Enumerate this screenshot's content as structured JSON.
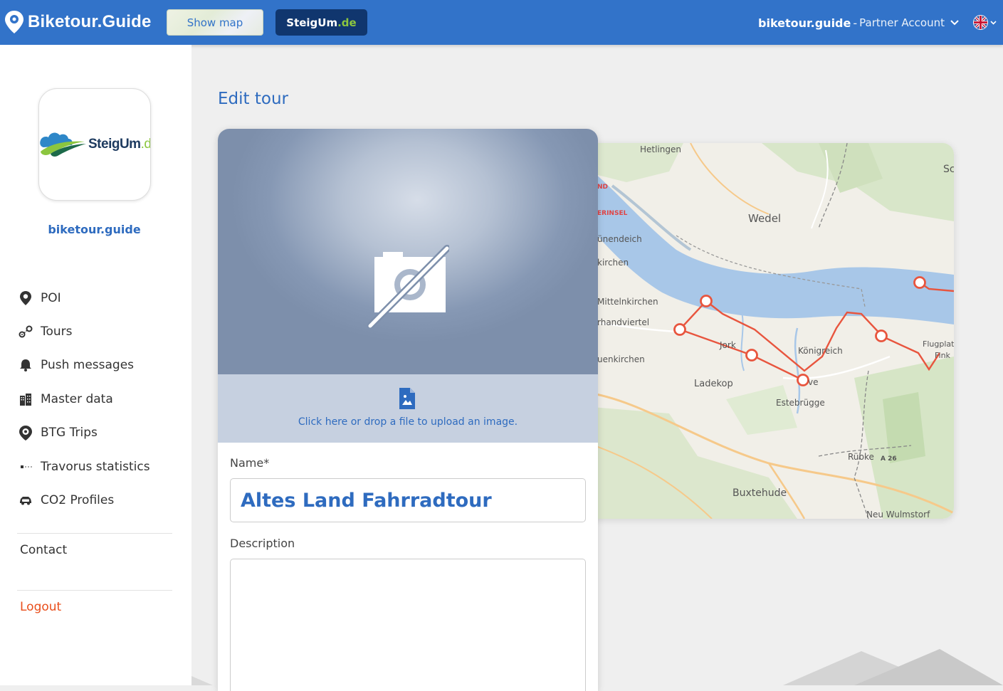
{
  "header": {
    "brand": "Biketour.Guide",
    "show_map_label": "Show map",
    "partner_button": {
      "name": "SteigUm",
      "tld": ".de"
    },
    "account": {
      "site": "biketour.guide",
      "separator": "-",
      "role": "Partner Account"
    },
    "language": "en"
  },
  "sidebar": {
    "logo": {
      "name": "SteigUm",
      "tld": ".de"
    },
    "site_name": "biketour.guide",
    "nav": [
      {
        "label": "POI",
        "icon": "map-pin-icon"
      },
      {
        "label": "Tours",
        "icon": "route-icon"
      },
      {
        "label": "Push messages",
        "icon": "bell-icon"
      },
      {
        "label": "Master data",
        "icon": "building-icon"
      },
      {
        "label": "BTG Trips",
        "icon": "trip-pin-icon"
      },
      {
        "label": "Travorus statistics",
        "icon": "statistics-icon"
      },
      {
        "label": "CO2 Profiles",
        "icon": "co2-car-icon"
      }
    ],
    "contact": "Contact",
    "logout": "Logout"
  },
  "main": {
    "title": "Edit tour",
    "upload_text": "Click here or drop a file to upload an image.",
    "name_label": "Name*",
    "name_value": "Altes Land Fahrradtour",
    "description_label": "Description",
    "description_value": ""
  },
  "map": {
    "labels": [
      "Hetlingen",
      "Wedel",
      "ND",
      "ERINSEL",
      "ünendeich",
      "kirchen",
      "Mittelnkirchen",
      "rhandviertel",
      "uenkirchen",
      "Jork",
      "Königreich",
      "Ladekop",
      "ve",
      "Estebrügge",
      "Rübke",
      "A 26",
      "Buxtehude",
      "Neu Wulmstorf",
      "Flugplat",
      "Fink",
      "Sc"
    ]
  },
  "colors": {
    "header_bg": "#3273c9",
    "accent": "#2e6bbf",
    "partner_bg": "#10366e",
    "logout": "#e94e1b",
    "route": "#e8553e"
  }
}
